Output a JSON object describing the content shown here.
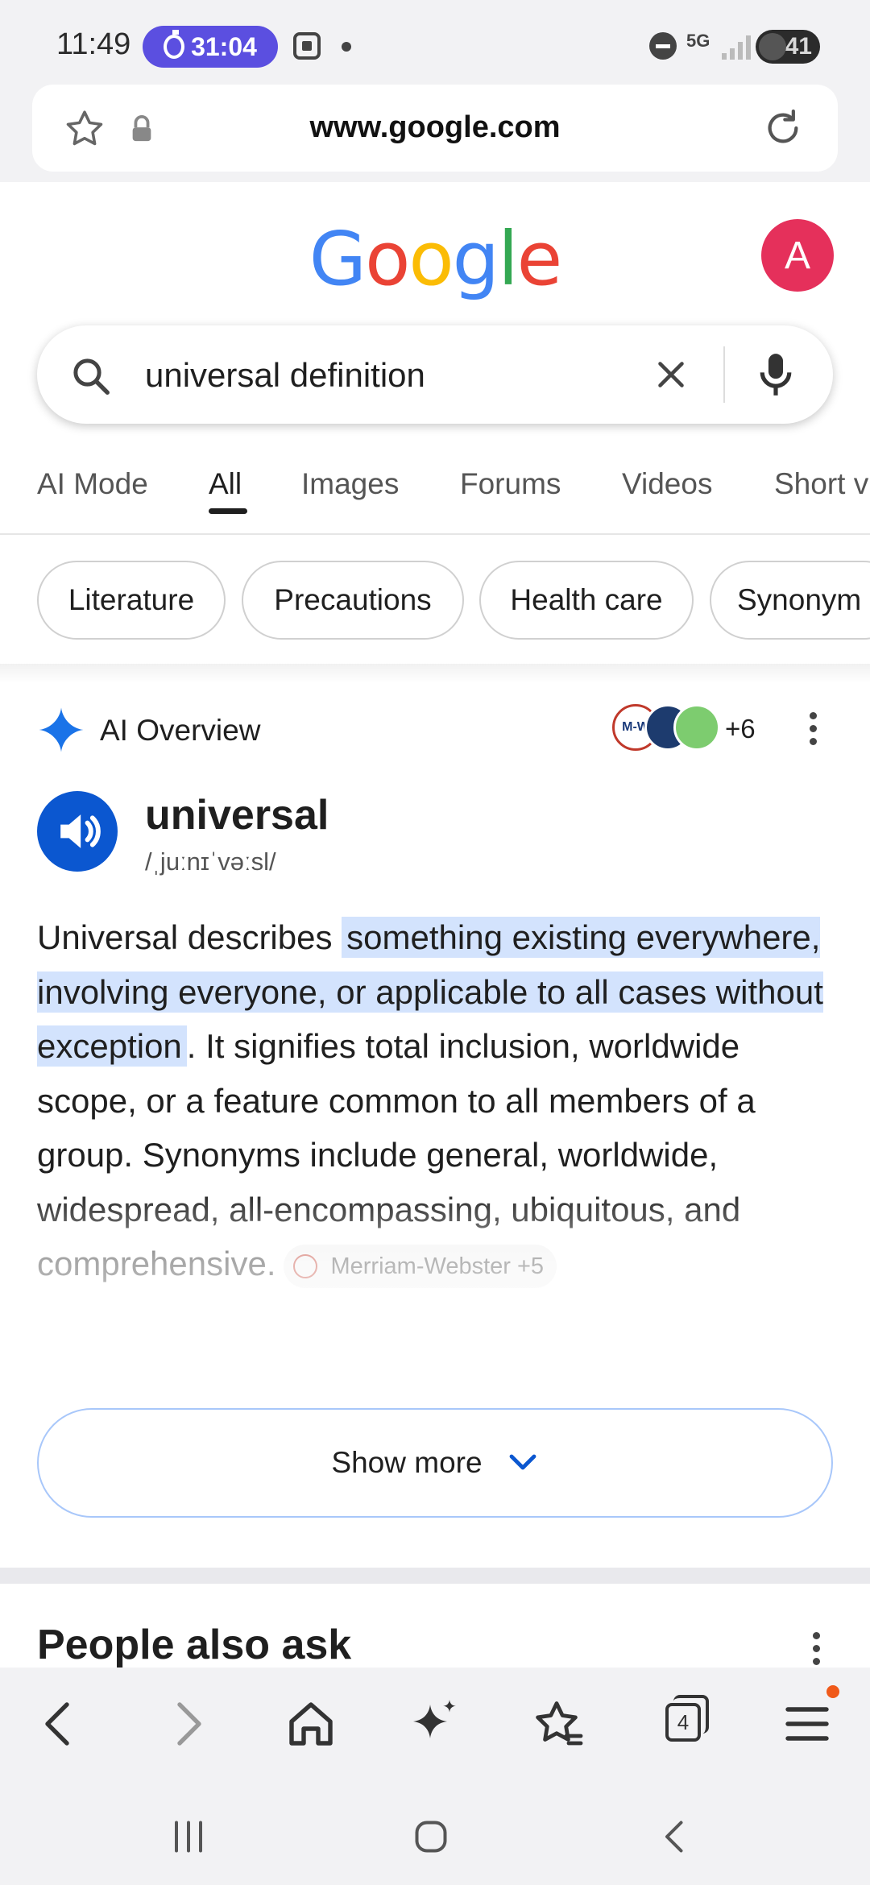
{
  "status_bar": {
    "time": "11:49",
    "timer": "31:04",
    "network": "5G",
    "battery": "41"
  },
  "url_bar": {
    "url": "www.google.com"
  },
  "google": {
    "logo_letters": [
      "G",
      "o",
      "o",
      "g",
      "l",
      "e"
    ],
    "logo_colors": [
      "#4285f4",
      "#ea4335",
      "#fbbc05",
      "#4285f4",
      "#34a853",
      "#ea4335"
    ],
    "avatar_letter": "A",
    "avatar_color": "#e5305b"
  },
  "search": {
    "query": "universal definition"
  },
  "tabs": [
    "AI Mode",
    "All",
    "Images",
    "Forums",
    "Videos",
    "Short v"
  ],
  "active_tab": "All",
  "chips": [
    "Literature",
    "Precautions",
    "Health care",
    "Synonym"
  ],
  "ai_overview": {
    "title": "AI Overview",
    "source_logo_text": "M-W",
    "source_count": "+6",
    "word": "universal",
    "pronunciation": "/ˌjuːnɪˈvəːsl/",
    "body_intro": "Universal describes ",
    "body_highlight": "something existing everywhere, involving everyone, or applicable to all cases without exception",
    "body_rest": ". It signifies total inclusion, worldwide scope, or a feature common to all members of a group. Synonyms include general, worldwide, widespread, all-encompassing, ubiquitous, and comprehensive.",
    "citation": "Merriam-Webster +5",
    "show_more": "Show more"
  },
  "people_also_ask": {
    "title": "People also ask"
  },
  "toolbar": {
    "tab_count": "4"
  }
}
